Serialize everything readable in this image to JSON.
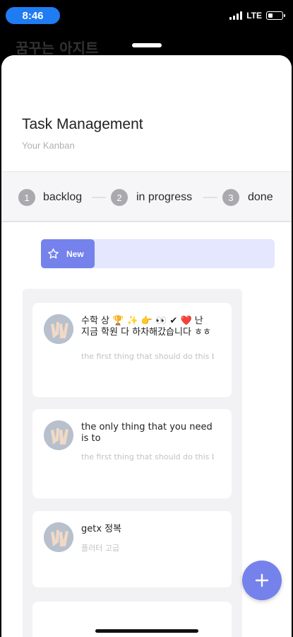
{
  "status_bar": {
    "time": "8:46",
    "network": "LTE",
    "battery_percent": 35
  },
  "background": {
    "title": "꿈꾸는 아지트"
  },
  "header": {
    "title": "Task Management",
    "subtitle": "Your Kanban"
  },
  "steps": [
    {
      "number": "1",
      "label": "backlog"
    },
    {
      "number": "2",
      "label": "in progress"
    },
    {
      "number": "3",
      "label": "done"
    }
  ],
  "new_button": {
    "label": "New",
    "icon": "star-icon"
  },
  "cards": [
    {
      "title_line1": "수학 상 🏆 ✨ 👉 👀 ✔ ❤️ 난",
      "title_line2": "지금 학원 다 하차해갔습니다 ㅎㅎ",
      "description": "the first thing that should do this book"
    },
    {
      "title_line1": "the only thing that you need",
      "title_line2": "is to",
      "description": "the first thing that should do this book"
    },
    {
      "title_line1": "getx 정복",
      "title_line2": "",
      "description": "플러터 고급"
    }
  ],
  "fab": {
    "icon": "plus-icon"
  },
  "colors": {
    "accent": "#7582ec",
    "accent_light": "#e4e7fd",
    "status_time": "#1f7cf2"
  }
}
